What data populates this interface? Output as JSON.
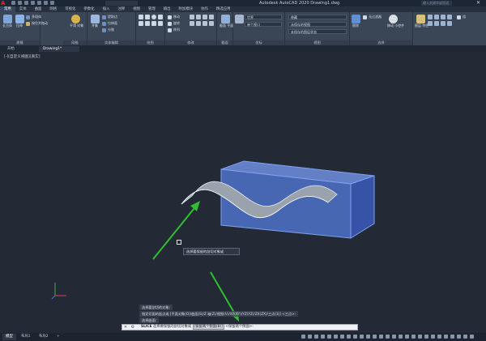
{
  "app": {
    "title": "Autodesk AutoCAD 2020   Drawing1.dwg",
    "search_placeholder": "",
    "right_search_placeholder": "键入关键字或短语",
    "close_glyph": "✕",
    "logo_text": "A"
  },
  "menu_tabs": [
    {
      "label": "常用"
    },
    {
      "label": "实体"
    },
    {
      "label": "曲面"
    },
    {
      "label": "网格"
    },
    {
      "label": "可视化"
    },
    {
      "label": "参数化"
    },
    {
      "label": "插入"
    },
    {
      "label": "注释"
    },
    {
      "label": "视图"
    },
    {
      "label": "管理"
    },
    {
      "label": "输出"
    },
    {
      "label": "附加模块"
    },
    {
      "label": "协作"
    },
    {
      "label": "精选应用"
    }
  ],
  "ribbon": {
    "panels": {
      "modeling": "建模",
      "mesh": "网格",
      "solid_edit": "实体编辑",
      "draw": "绘图",
      "modify": "修改",
      "section": "截面",
      "coordinates": "坐标",
      "view": "视图",
      "selection": "选择"
    },
    "buttons": {
      "box": "长方体",
      "extrude": "拉伸",
      "smooth": "平滑\n对象",
      "union": "并集",
      "section_plane": "截面\n平面",
      "culling": "剔除",
      "no_filter": "无过滤器",
      "gizmo": "移动\n小控件",
      "group": "组",
      "layers": "图层\n特性",
      "multi_body": "多段体",
      "presspull": "按住并拖动",
      "extract_edges": "提取边",
      "extrude_face": "拉伸面",
      "separate": "分割",
      "move": "移动",
      "rotate": "旋转",
      "array": "阵列",
      "world": "世界",
      "visual_style": "隐藏",
      "unsaved_view": "未保存的视图",
      "single_viewport": "单个视口",
      "unsaved_layer_state": "未保存的图层状态"
    }
  },
  "file_tabs": [
    {
      "label": "开始"
    },
    {
      "label": "Drawing1*"
    }
  ],
  "viewport": {
    "label": "[-][自定义视图][真实]",
    "tooltip": "选择要保留的剖切对象或",
    "box_color": "#4f72c8",
    "arrow_color": "#2fbf2f"
  },
  "command_history": [
    {
      "text": "选择要剖切的对象:"
    },
    {
      "text": "指定切面的起点或 [平面对象(O)/曲面(S)/Z 轴(Z)/视图(V)/XY(XY)/YZ(YZ)/ZX(ZX)/三点(3)] <三点>:"
    },
    {
      "text": "选择曲面:"
    }
  ],
  "command_input": {
    "prefix": "SLICE",
    "text": "选择要保留的剖切对象或",
    "option": "[保留两个侧面(B)]",
    "suffix": "<保留两个侧面>:"
  },
  "status_tabs": [
    {
      "label": "模型"
    },
    {
      "label": "布局1"
    },
    {
      "label": "布局2"
    },
    {
      "label": "+"
    }
  ]
}
